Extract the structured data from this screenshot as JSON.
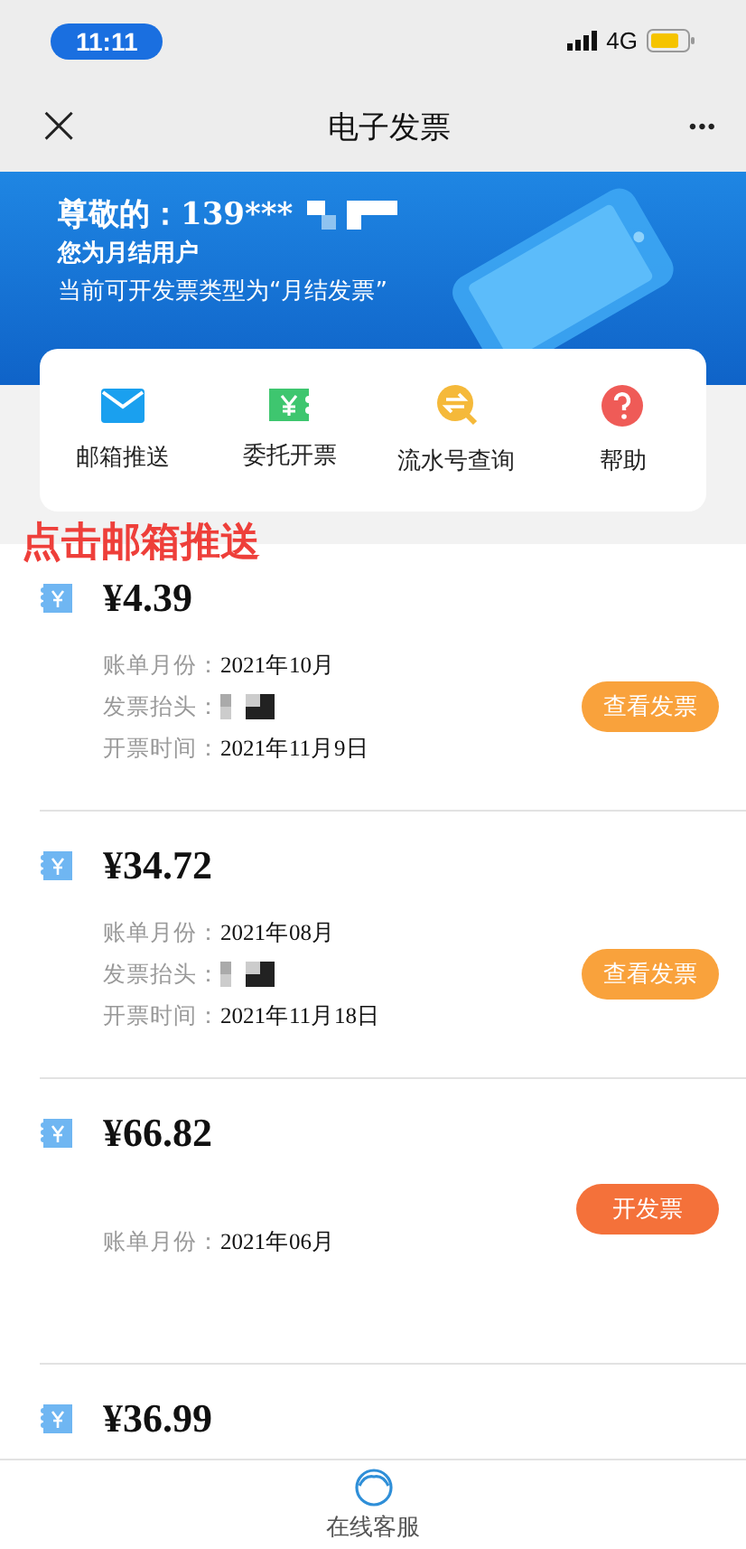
{
  "status_bar": {
    "time": "11:11",
    "network": "4G"
  },
  "nav": {
    "close": "×",
    "title": "电子发票",
    "more": "•••"
  },
  "banner": {
    "greeting": "尊敬的：139***",
    "user_type": "您为月结用户",
    "invoice_type": "当前可开发票类型为“月结发票”"
  },
  "quick_actions": [
    {
      "label": "邮箱推送",
      "kind": "mail"
    },
    {
      "label": "委托开票",
      "kind": "ticket"
    },
    {
      "label": "流水号查询",
      "kind": "search"
    },
    {
      "label": "帮助",
      "kind": "help"
    }
  ],
  "annotation": "点击邮箱推送",
  "invoices": [
    {
      "amount": "¥4.39",
      "rows": [
        {
          "label": "账单月份：",
          "value": "2021年10月",
          "kind": "text"
        },
        {
          "label": "发票抬头：",
          "kind": "redacted"
        },
        {
          "label": "开票时间：",
          "value": "2021年11月9日",
          "kind": "text"
        }
      ],
      "button": {
        "label": "查看发票",
        "kind": "view"
      }
    },
    {
      "amount": "¥34.72",
      "rows": [
        {
          "label": "账单月份：",
          "value": "2021年08月",
          "kind": "text"
        },
        {
          "label": "发票抬头：",
          "kind": "redacted"
        },
        {
          "label": "开票时间：",
          "value": "2021年11月18日",
          "kind": "text"
        }
      ],
      "button": {
        "label": "查看发票",
        "kind": "view"
      }
    },
    {
      "amount": "¥66.82",
      "rows": [
        {
          "label": "账单月份：",
          "value": "2021年06月",
          "kind": "text"
        }
      ],
      "button": {
        "label": "开发票",
        "kind": "issue"
      }
    },
    {
      "amount": "¥36.99"
    }
  ],
  "bottom_bar": {
    "label": "在线客服"
  }
}
